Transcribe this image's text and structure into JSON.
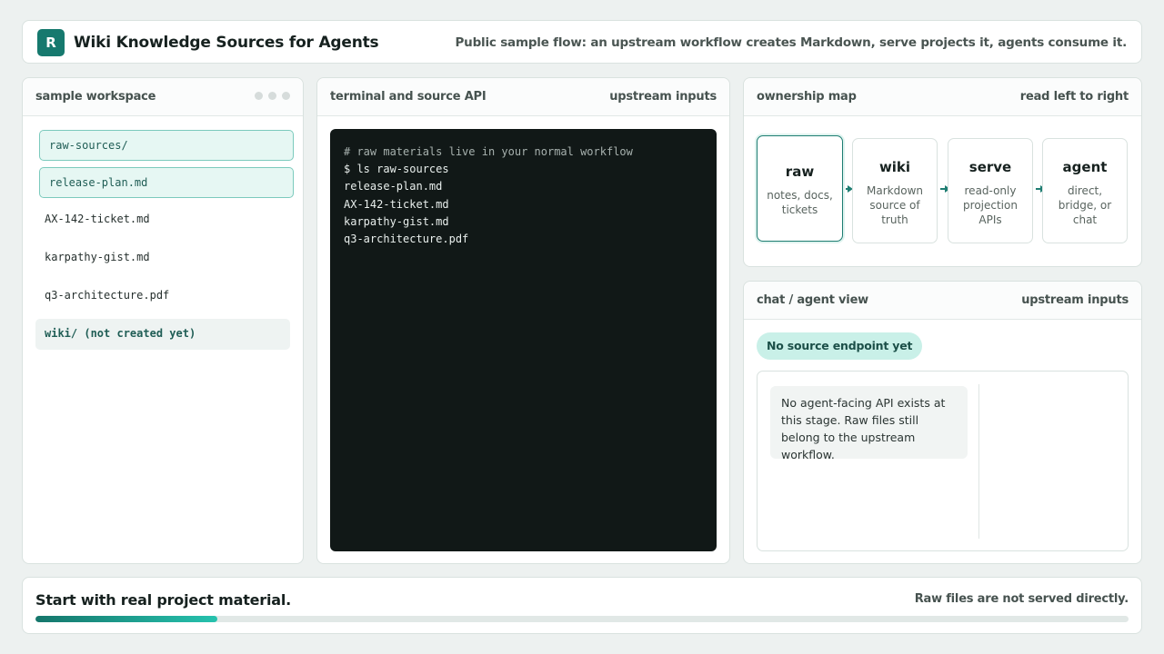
{
  "header": {
    "logo_letter": "R",
    "title": "Wiki Knowledge Sources for Agents",
    "subtitle": "Public sample flow: an upstream workflow creates Markdown, serve projects it, agents consume it."
  },
  "workspace": {
    "title": "sample workspace",
    "files": [
      "raw-sources/",
      "release-plan.md",
      "AX-142-ticket.md",
      "karpathy-gist.md",
      "q3-architecture.pdf",
      "wiki/ (not created yet)"
    ]
  },
  "terminal": {
    "title": "terminal and source API",
    "tag": "upstream inputs",
    "lines": [
      "# raw materials live in your normal workflow",
      "$ ls raw-sources",
      "release-plan.md",
      "AX-142-ticket.md",
      "karpathy-gist.md",
      "q3-architecture.pdf"
    ]
  },
  "ownership": {
    "title": "ownership map",
    "tag": "read left to right",
    "stages": [
      {
        "name": "raw",
        "desc": "notes, docs, tickets"
      },
      {
        "name": "wiki",
        "desc": "Markdown source of truth"
      },
      {
        "name": "serve",
        "desc": "read-only projection APIs"
      },
      {
        "name": "agent",
        "desc": "direct, bridge, or chat"
      }
    ]
  },
  "chat": {
    "title": "chat / agent view",
    "tag": "upstream inputs",
    "badge": "No source endpoint yet",
    "message": "No agent-facing API exists at this stage. Raw files still belong to the upstream workflow."
  },
  "footer": {
    "title": "Start with real project material.",
    "note": "Raw files are not served directly.",
    "progress": 0.1667
  },
  "colors": {
    "accent": "#16796e",
    "terminal_bg": "#111817",
    "badge_bg": "#c9f0e8"
  }
}
